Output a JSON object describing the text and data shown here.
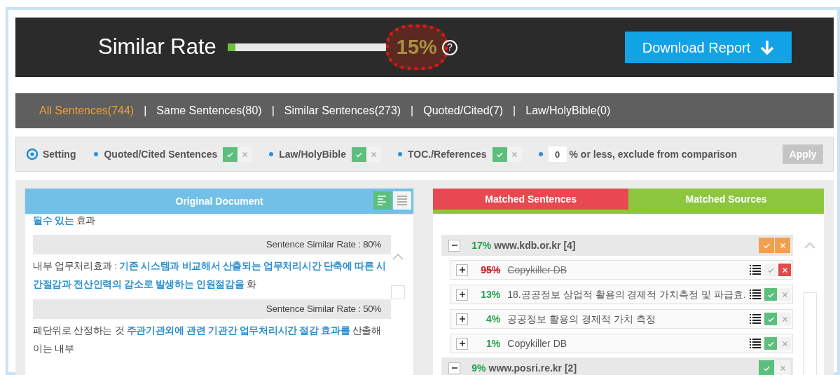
{
  "header": {
    "title": "Similar Rate",
    "level": 0.05,
    "reading": "15%",
    "help": "?",
    "download": "Download Report"
  },
  "filters": [
    {
      "label": "All Sentences(744)",
      "selected": true
    },
    {
      "label": "Same Sentences(80)",
      "selected": false
    },
    {
      "label": "Similar Sentences(273)",
      "selected": false
    },
    {
      "label": "Quoted/Cited(7)",
      "selected": false
    },
    {
      "label": "Law/HolyBible(0)",
      "selected": false
    }
  ],
  "filter_separator": "|",
  "settings": {
    "label": "Setting",
    "options": [
      {
        "label": "Quoted/Cited Sentences",
        "checked": true
      },
      {
        "label": "Law/HolyBible",
        "checked": true
      },
      {
        "label": "TOC./References",
        "checked": true
      }
    ],
    "threshold": {
      "value": "0",
      "label": "% or less, exclude from comparison"
    },
    "apply": {
      "label": "Apply",
      "disabled": true
    }
  },
  "original_document": {
    "title": "Original Document",
    "views": [
      {
        "selected": true
      },
      {
        "selected": false
      }
    ],
    "lead": [
      {
        "text": "될수 있는",
        "matched": true
      },
      {
        "text": "효과",
        "matched": false
      }
    ],
    "sentences": [
      {
        "rate": "Sentence Similar Rate : 80%",
        "segments": [
          {
            "text": "내부 업무처리효과 :",
            "matched": false
          },
          {
            "text": "기존 시스템과 비교해서 산출되는 업무처리시간 단축에 따른 시간절감과 전산인력의 감소로 발생하는 인원절감을",
            "matched": true
          },
          {
            "text": "화",
            "matched": false
          }
        ]
      },
      {
        "rate": "Sentence Similar Rate : 50%",
        "segments": [
          {
            "text": "폐단위로 산정하는 것",
            "matched": false
          },
          {
            "text": "주관기관외에 관련 기관간 업무처리시간 절감 효과를",
            "matched": true
          },
          {
            "text": "산출해 이는 내부",
            "matched": false
          }
        ]
      }
    ]
  },
  "matches": {
    "tabs": [
      {
        "label": "Matched Sentences",
        "selected": false,
        "color": "#e8484f"
      },
      {
        "label": "Matched Sources",
        "selected": true,
        "color": "#8cc63f"
      }
    ],
    "groups": [
      {
        "expanded": true,
        "percent": "17%",
        "name": "www.kdb.or.kr [4]",
        "kind": "orange",
        "sources": [
          {
            "percent": "95%",
            "name": "Copykiller DB",
            "included": false
          },
          {
            "percent": "13%",
            "name": "18.공공정보 상업적 활용의 경제적 가치측정 및 파급효.",
            "included": true
          },
          {
            "percent": "4%",
            "name": "공공정보 활용의 경제적 가치 측정",
            "included": true
          },
          {
            "percent": "1%",
            "name": "Copykiller DB",
            "included": true
          }
        ]
      },
      {
        "expanded": true,
        "percent": "9%",
        "name": "www.posri.re.kr [2]",
        "kind": "green"
      }
    ]
  }
}
